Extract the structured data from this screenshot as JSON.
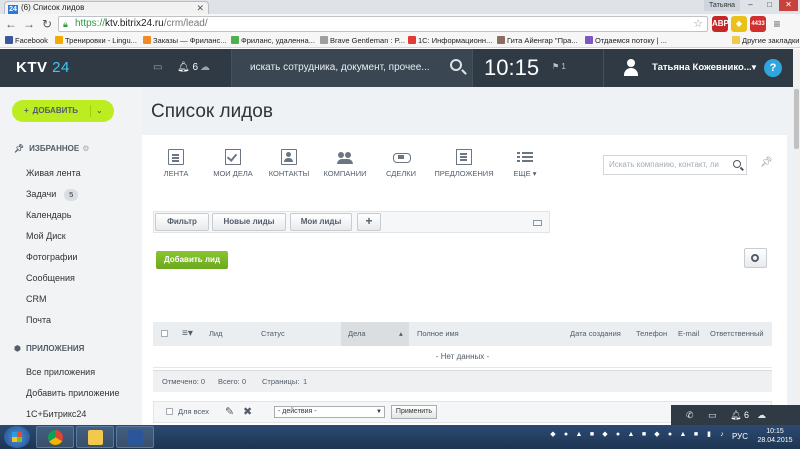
{
  "browser": {
    "tab_title": "(6) Список лидов",
    "tab_favicon": "24",
    "window_user": "Татьяна",
    "url_secure": "https://",
    "url_host": "ktv.bitrix24.ru",
    "url_path": "/crm/lead/",
    "bookmarks": [
      "Facebook",
      "Тренировки - Lingu...",
      "Заказы — Фриланс...",
      "Фриланс, удаленна...",
      "Brave Gentleman : P...",
      "1С: Информационн...",
      "Гита Айенгар \"Пра...",
      "Отдаемся потоку | ...",
      "Другие закладки"
    ],
    "ext_badge": "4433"
  },
  "header": {
    "logo_text": "KTV",
    "logo_num": "24",
    "notif_count": "6",
    "search_placeholder": "искать сотрудника, документ, прочее...",
    "clock": "10:15",
    "clock_sub": "1",
    "user_name": "Татьяна Кожевнико...",
    "help": "?"
  },
  "sidebar": {
    "add_label": "ДОБАВИТЬ",
    "favorites_title": "ИЗБРАННОЕ",
    "items": [
      {
        "label": "Живая лента"
      },
      {
        "label": "Задачи",
        "count": "5"
      },
      {
        "label": "Календарь"
      },
      {
        "label": "Мой Диск"
      },
      {
        "label": "Фотографии"
      },
      {
        "label": "Сообщения"
      },
      {
        "label": "CRM"
      },
      {
        "label": "Почта"
      }
    ],
    "apps_title": "ПРИЛОЖЕНИЯ",
    "apps": [
      {
        "label": "Все приложения"
      },
      {
        "label": "Добавить приложение"
      },
      {
        "label": "1С+Битрикс24"
      }
    ]
  },
  "main": {
    "page_title": "Список лидов",
    "crm_nav": [
      {
        "label": "ЛЕНТА",
        "icon": "feed-icon"
      },
      {
        "label": "МОИ ДЕЛА",
        "icon": "tasks-icon"
      },
      {
        "label": "КОНТАКТЫ",
        "icon": "contacts-icon"
      },
      {
        "label": "КОМПАНИИ",
        "icon": "companies-icon"
      },
      {
        "label": "СДЕЛКИ",
        "icon": "deals-icon"
      },
      {
        "label": "ПРЕДЛОЖЕНИЯ",
        "icon": "offers-icon"
      },
      {
        "label": "ЕЩЕ",
        "icon": "more-icon"
      }
    ],
    "card_search_placeholder": "Искать компанию, контакт, ли",
    "filters": {
      "filter_label": "Фильтр",
      "new_leads_label": "Новые лиды",
      "my_leads_label": "Мои лиды",
      "add_label": "+"
    },
    "add_lead_label": "Добавить лид",
    "columns": [
      "Лид",
      "Статус",
      "Дела",
      "Полное имя",
      "Дата создания",
      "Телефон",
      "E-mail",
      "Ответственный"
    ],
    "empty_text": "- Нет данных -",
    "footer": {
      "marked": "Отмечено: 0",
      "total": "Всего: 0",
      "pages": "Страницы:",
      "page_num": "1"
    },
    "actions": {
      "for_all": "Для всех",
      "select_value": "- действия -",
      "apply": "Применить"
    }
  },
  "im_bar": {
    "notif_count": "6"
  },
  "taskbar": {
    "lang": "РУС",
    "time": "10:15",
    "date": "28.04.2015"
  },
  "colors": {
    "header_bg": "#2f3a44",
    "add_button": "#bbed21",
    "add_lead": "#7ab526",
    "help": "#2fa6e0",
    "logo_accent": "#3bc8f5"
  }
}
